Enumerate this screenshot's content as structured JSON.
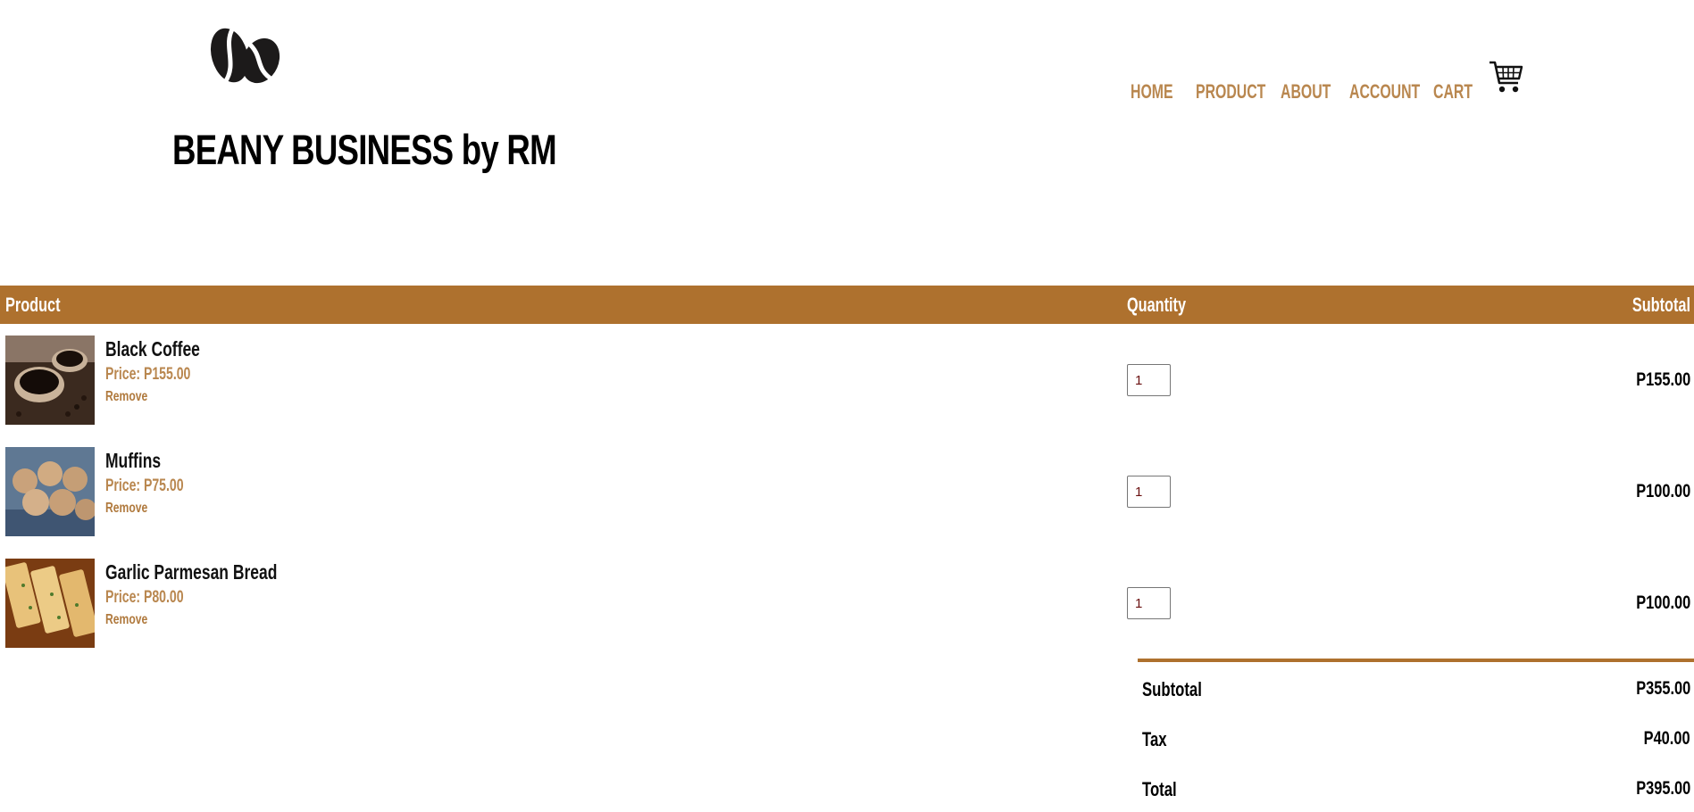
{
  "brand": {
    "name": "BEANY BUSINESS by RM",
    "logo_icon": "coffee-bean-icon"
  },
  "nav": {
    "items": [
      "HOME",
      "PRODUCT",
      "ABOUT",
      "ACCOUNT",
      "CART"
    ],
    "cart_icon": "shopping-cart-icon"
  },
  "cart": {
    "headers": {
      "product": "Product",
      "quantity": "Quantity",
      "subtotal": "Subtotal"
    },
    "items": [
      {
        "name": "Black Coffee",
        "price": "Price: P155.00",
        "remove": "Remove",
        "quantity": "1",
        "subtotal": "P155.00",
        "image_icon": "black-coffee-image"
      },
      {
        "name": "Muffins",
        "price": "Price: P75.00",
        "remove": "Remove",
        "quantity": "1",
        "subtotal": "P100.00",
        "image_icon": "muffins-image"
      },
      {
        "name": "Garlic Parmesan Bread",
        "price": "Price: P80.00",
        "remove": "Remove",
        "quantity": "1",
        "subtotal": "P100.00",
        "image_icon": "garlic-bread-image"
      }
    ],
    "totals": {
      "subtotal_label": "Subtotal",
      "subtotal_value": "P355.00",
      "tax_label": "Tax",
      "tax_value": "P40.00",
      "total_label": "Total",
      "total_value": "P395.00"
    }
  },
  "colors": {
    "accent": "#ae712e",
    "nav_link": "#b9874f"
  }
}
